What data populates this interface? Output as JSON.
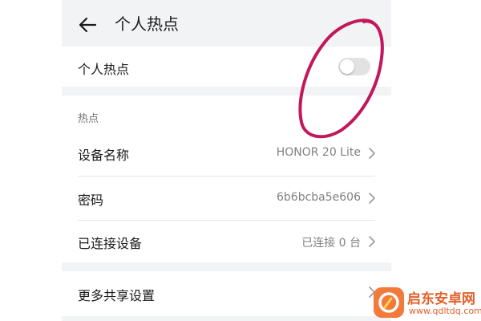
{
  "header": {
    "back_icon": "arrow-left-icon",
    "title": "个人热点"
  },
  "hotspot_toggle": {
    "label": "个人热点",
    "enabled": false
  },
  "hotspot_section": {
    "title": "热点",
    "items": [
      {
        "label": "设备名称",
        "value": "HONOR 20 Lite"
      },
      {
        "label": "密码",
        "value": "6b6bcba5e606"
      },
      {
        "label": "已连接设备",
        "value": "已连接 0 台"
      }
    ]
  },
  "more_settings": {
    "label": "更多共享设置"
  },
  "annotation": {
    "color": "#c2185b"
  },
  "watermark": {
    "title": "启东安卓网",
    "url": "www.qdltdq.com"
  },
  "colors": {
    "page_background": "#f1f3f5",
    "card_background": "#ffffff",
    "secondary_text": "#808080",
    "toggle_off": "#e2e2e2"
  }
}
